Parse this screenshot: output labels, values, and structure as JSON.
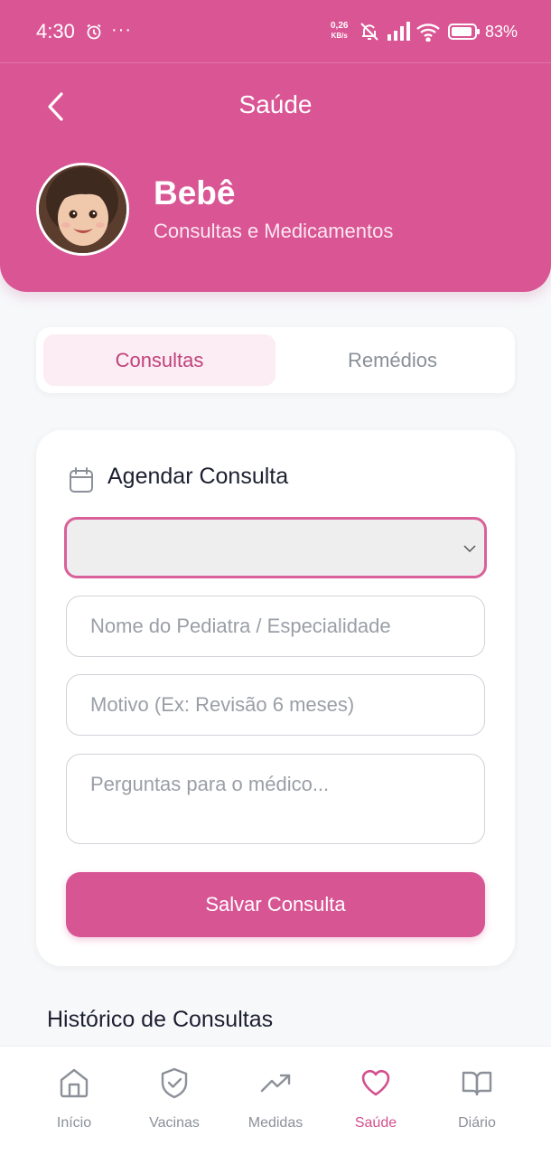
{
  "status_bar": {
    "time": "4:30",
    "more": "···",
    "net_speed_value": "0,26",
    "net_speed_unit": "KB/s",
    "battery": "83%"
  },
  "header": {
    "title": "Saúde",
    "profile_name": "Bebê",
    "profile_subtitle": "Consultas e Medicamentos"
  },
  "tabs": [
    {
      "label": "Consultas",
      "active": true
    },
    {
      "label": "Remédios",
      "active": false
    }
  ],
  "form": {
    "title": "Agendar Consulta",
    "select_value": "",
    "doctor_placeholder": "Nome do Pediatra / Especialidade",
    "reason_placeholder": "Motivo (Ex: Revisão 6 meses)",
    "questions_placeholder": "Perguntas para o médico...",
    "save_label": "Salvar Consulta"
  },
  "history": {
    "title": "Histórico de Consultas"
  },
  "bottom_nav": [
    {
      "label": "Início",
      "icon": "home-icon",
      "active": false
    },
    {
      "label": "Vacinas",
      "icon": "shield-check-icon",
      "active": false
    },
    {
      "label": "Medidas",
      "icon": "trending-up-icon",
      "active": false
    },
    {
      "label": "Saúde",
      "icon": "heart-icon",
      "active": true
    },
    {
      "label": "Diário",
      "icon": "book-icon",
      "active": false
    }
  ],
  "colors": {
    "brand": "#d95594",
    "active_nav": "#d3508f",
    "inactive": "#8c9099"
  }
}
